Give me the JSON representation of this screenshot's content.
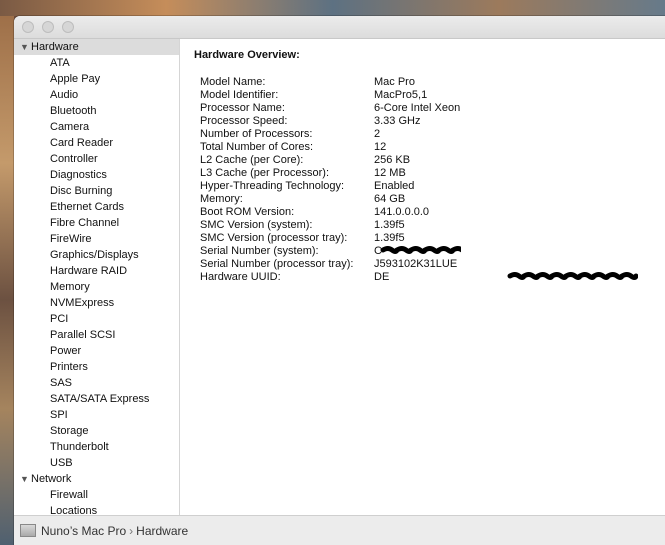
{
  "sidebar": {
    "categories": [
      {
        "label": "Hardware",
        "expanded": true,
        "selected": true,
        "items": [
          "ATA",
          "Apple Pay",
          "Audio",
          "Bluetooth",
          "Camera",
          "Card Reader",
          "Controller",
          "Diagnostics",
          "Disc Burning",
          "Ethernet Cards",
          "Fibre Channel",
          "FireWire",
          "Graphics/Displays",
          "Hardware RAID",
          "Memory",
          "NVMExpress",
          "PCI",
          "Parallel SCSI",
          "Power",
          "Printers",
          "SAS",
          "SATA/SATA Express",
          "SPI",
          "Storage",
          "Thunderbolt",
          "USB"
        ]
      },
      {
        "label": "Network",
        "expanded": true,
        "selected": false,
        "items": [
          "Firewall",
          "Locations"
        ]
      }
    ]
  },
  "overview": {
    "title": "Hardware Overview:",
    "rows": [
      {
        "label": "Model Name:",
        "value": "Mac Pro"
      },
      {
        "label": "Model Identifier:",
        "value": "MacPro5,1"
      },
      {
        "label": "Processor Name:",
        "value": "6-Core Intel Xeon"
      },
      {
        "label": "Processor Speed:",
        "value": "3.33 GHz"
      },
      {
        "label": "Number of Processors:",
        "value": "2"
      },
      {
        "label": "Total Number of Cores:",
        "value": "12"
      },
      {
        "label": "L2 Cache (per Core):",
        "value": "256 KB"
      },
      {
        "label": "L3 Cache (per Processor):",
        "value": "12 MB"
      },
      {
        "label": "Hyper-Threading Technology:",
        "value": "Enabled"
      },
      {
        "label": "Memory:",
        "value": "64 GB"
      },
      {
        "label": "Boot ROM Version:",
        "value": "141.0.0.0.0"
      },
      {
        "label": "SMC Version (system):",
        "value": "1.39f5"
      },
      {
        "label": "SMC Version (processor tray):",
        "value": "1.39f5"
      },
      {
        "label": "Serial Number (system):",
        "value": "C"
      },
      {
        "label": "Serial Number (processor tray):",
        "value": "J593102K31LUE"
      },
      {
        "label": "Hardware UUID:",
        "value": "DE"
      }
    ]
  },
  "statusbar": {
    "computer_name": "Nuno’s Mac Pro",
    "separator": "›",
    "section": "Hardware"
  }
}
